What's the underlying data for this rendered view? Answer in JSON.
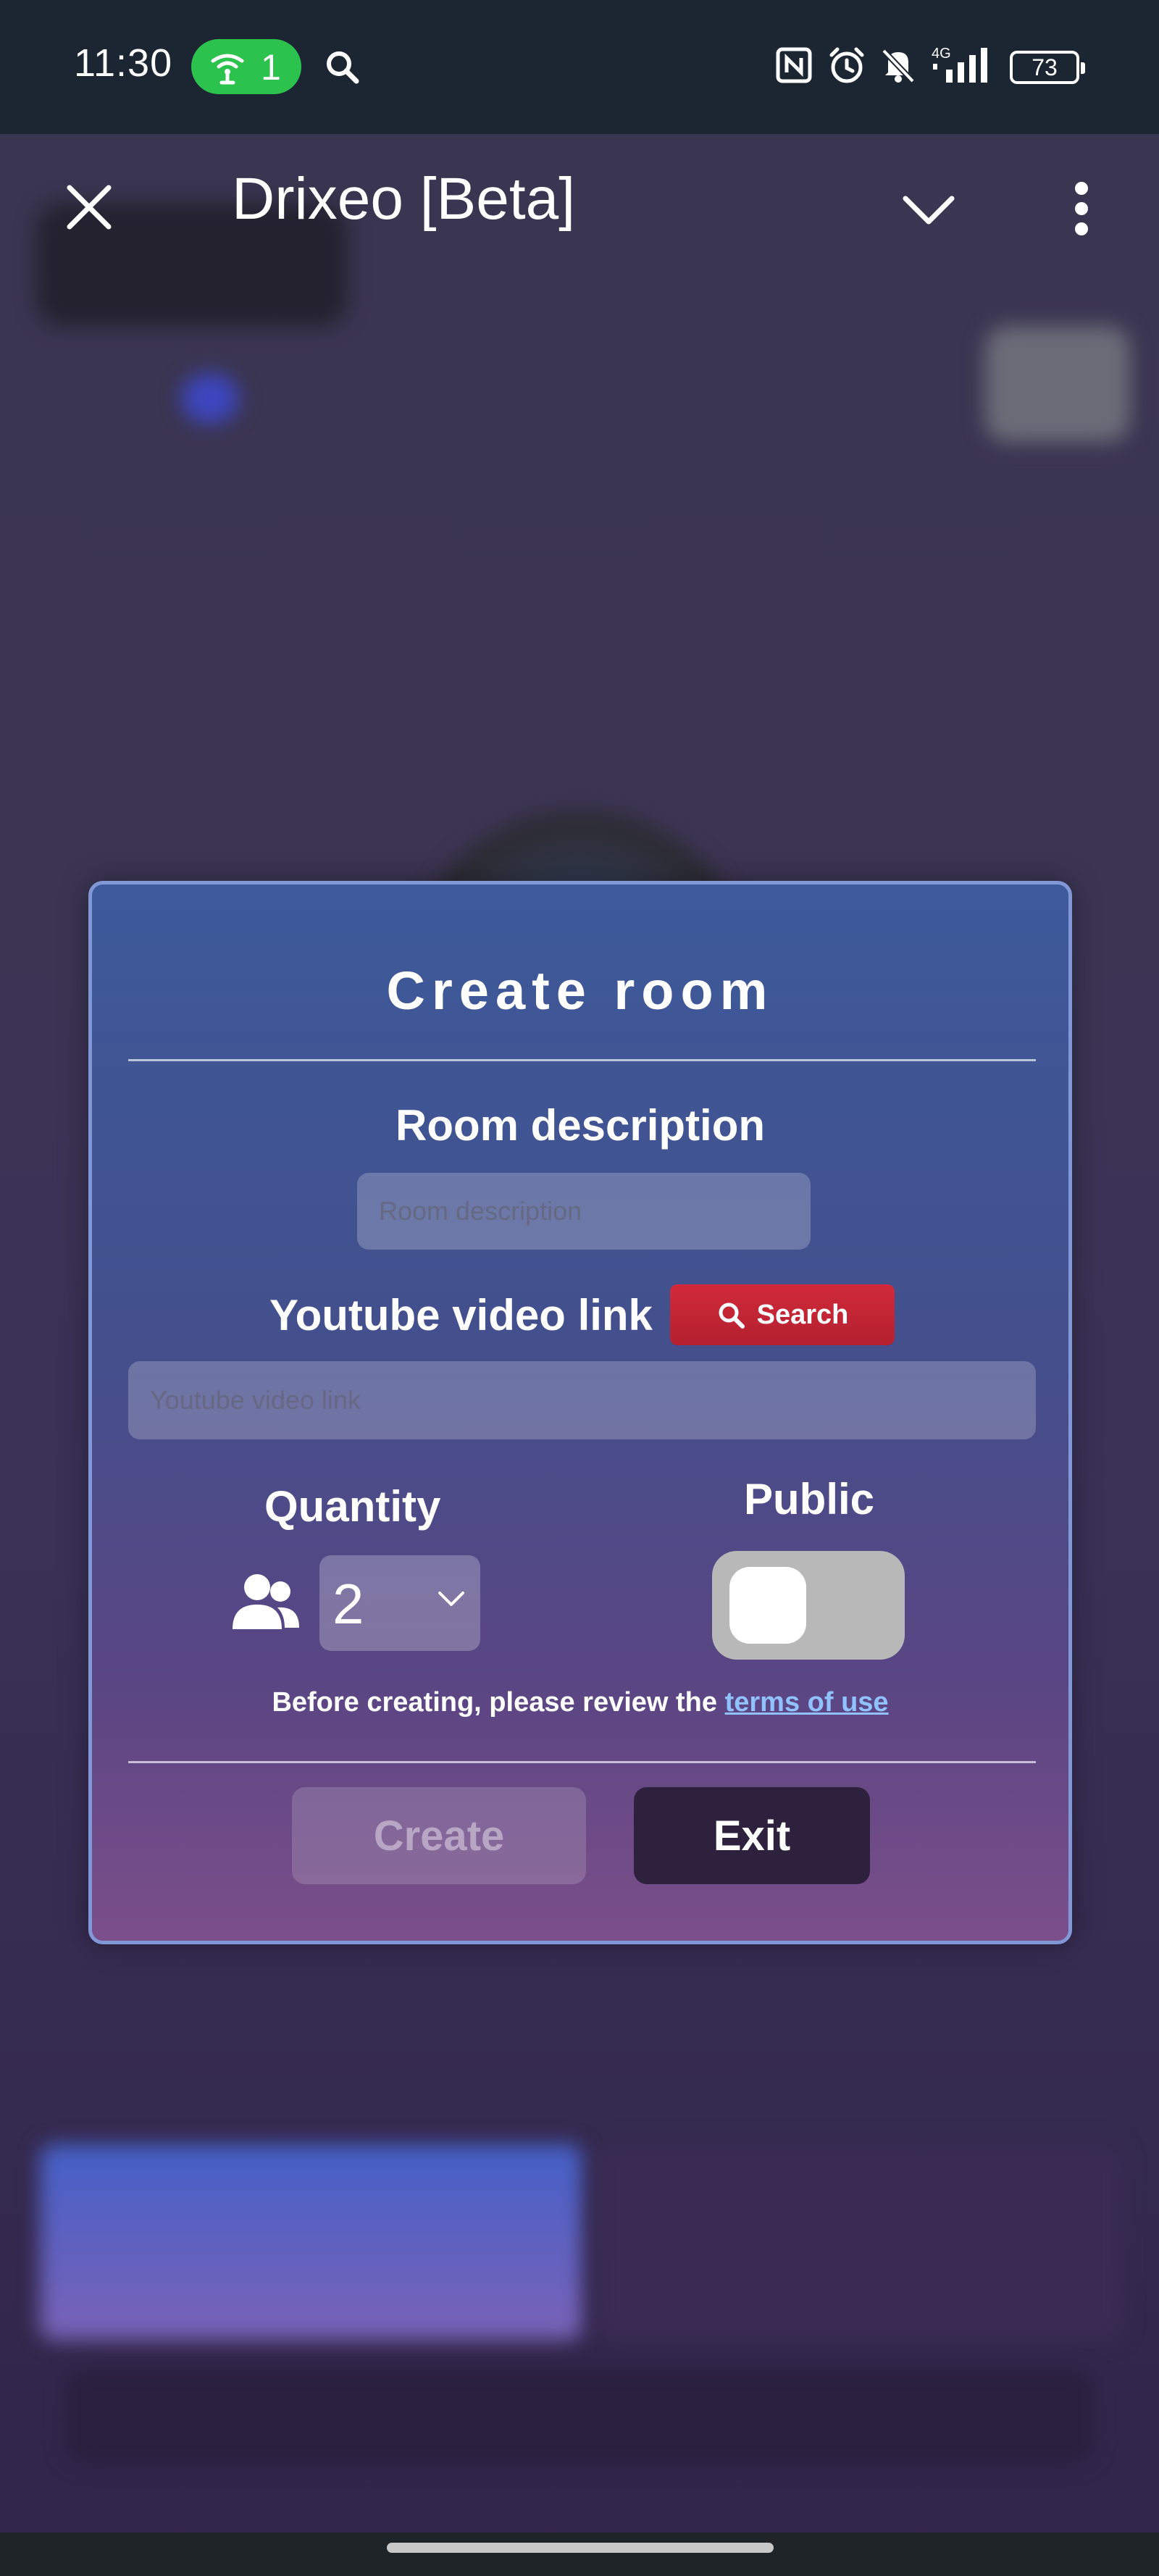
{
  "status_bar": {
    "time": "11:30",
    "hotspot_count": "1",
    "battery": "73",
    "icons": [
      "hotspot-icon",
      "search-icon",
      "nfc-icon",
      "alarm-icon",
      "mute-icon",
      "signal-4g-icon",
      "battery-icon"
    ]
  },
  "toolbar": {
    "title": "Drixeo [Beta]",
    "icons": [
      "close-icon",
      "chevron-down-icon",
      "more-vert-icon"
    ]
  },
  "dialog": {
    "title": "Create room",
    "room_description_label": "Room description",
    "room_description_placeholder": "Room description",
    "youtube_label": "Youtube video link",
    "search_button": "Search",
    "youtube_placeholder": "Youtube video link",
    "quantity_label": "Quantity",
    "quantity_value": "2",
    "public_label": "Public",
    "public_enabled": false,
    "terms_prefix": "Before creating, please review the ",
    "terms_link": "terms of use",
    "create_button": "Create",
    "exit_button": "Exit"
  },
  "colors": {
    "status_bar_bg": "#1c2532",
    "hotspot_green": "#2cc24e",
    "search_red": "#c62535",
    "exit_bg": "#2e213d",
    "terms_link": "#8fc2ff"
  }
}
